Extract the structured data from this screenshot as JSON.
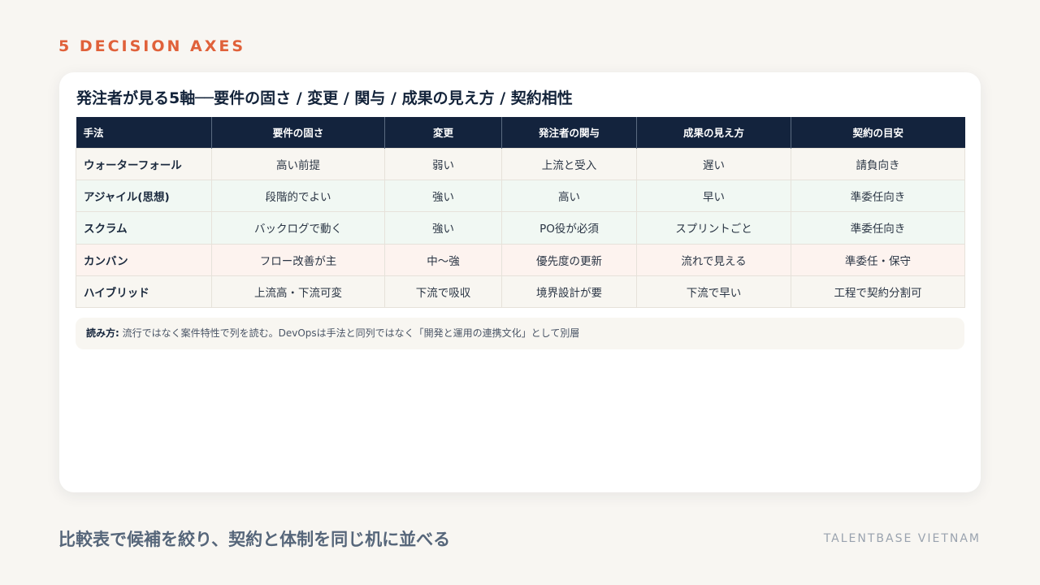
{
  "eyebrow": "5 DECISION AXES",
  "card": {
    "title": "発注者が見る5軸──要件の固さ / 変更 / 関与 / 成果の見え方 / 契約相性",
    "table": {
      "headers": [
        "手法",
        "要件の固さ",
        "変更",
        "発注者の関与",
        "成果の見え方",
        "契約の目安"
      ],
      "rows": [
        [
          "ウォーターフォール",
          "高い前提",
          "弱い",
          "上流と受入",
          "遅い",
          "請負向き"
        ],
        [
          "アジャイル(思想)",
          "段階的でよい",
          "強い",
          "高い",
          "早い",
          "準委任向き"
        ],
        [
          "スクラム",
          "バックログで動く",
          "強い",
          "PO役が必須",
          "スプリントごと",
          "準委任向き"
        ],
        [
          "カンバン",
          "フロー改善が主",
          "中〜強",
          "優先度の更新",
          "流れで見える",
          "準委任・保守"
        ],
        [
          "ハイブリッド",
          "上流高・下流可変",
          "下流で吸収",
          "境界設計が要",
          "下流で早い",
          "工程で契約分割可"
        ]
      ]
    },
    "note": {
      "label": "読み方:",
      "text": "流行ではなく案件特性で列を読む。DevOpsは手法と同列ではなく「開発と運用の連携文化」として別層"
    }
  },
  "footer": "比較表で候補を絞り、契約と体制を同じ机に並べる",
  "brand": "TALENTBASE VIETNAM",
  "colors": {
    "accent": "#e0613a",
    "header_bg": "#13233d",
    "row_neutral": "#f8f6f1",
    "row_green": "#f1f8f3",
    "row_pink": "#fdf3ef"
  }
}
